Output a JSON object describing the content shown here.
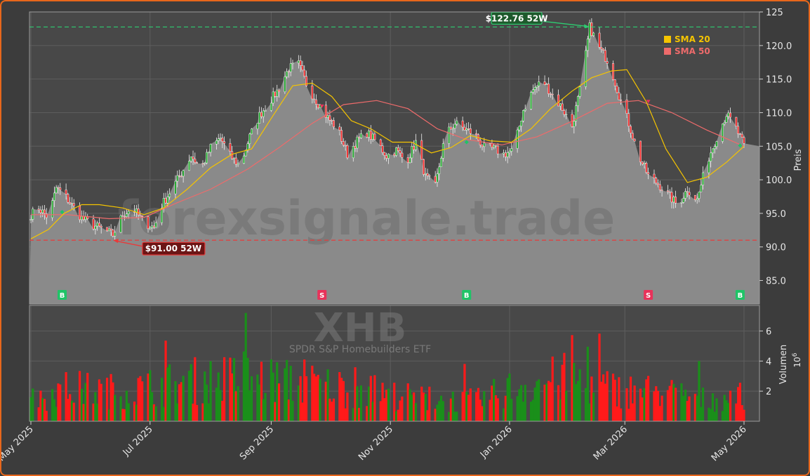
{
  "chart_data": {
    "type": "candlestick",
    "ticker": "XHB",
    "subtitle": "SPDR S&P Homebuilders ETF",
    "watermark": "forexsignale.trade",
    "ylabel": "Preis",
    "volume_label": "Volumen",
    "volume_exponent": "10",
    "volume_exponent_power": "6",
    "price_ylim": [
      81.5,
      125
    ],
    "price_ticks": [
      "85.0",
      "90.0",
      "95.0",
      "100.0",
      "105.0",
      "110.0",
      "115.0",
      "120.0",
      "125"
    ],
    "price_tick_values": [
      85,
      90,
      95,
      100,
      105,
      110,
      115,
      120,
      125
    ],
    "volume_ylim": [
      0,
      7.7
    ],
    "volume_ticks": [
      "2",
      "4",
      "6"
    ],
    "volume_tick_values": [
      2,
      4,
      6
    ],
    "x_ticks": [
      "May 2025",
      "Jul 2025",
      "Sep 2025",
      "Nov 2025",
      "Jan 2026",
      "Mar 2026",
      "May 2026"
    ],
    "x_tick_dates": [
      "2025-05-01",
      "2025-07-01",
      "2025-09-01",
      "2025-11-01",
      "2026-01-01",
      "2026-03-01",
      "2026-05-01"
    ],
    "date_range": [
      "2025-05-01",
      "2026-05-01"
    ],
    "last_price": 105.0,
    "high_52w": {
      "label": "$122.76 52W",
      "value": 122.76,
      "date": "2026-02-11"
    },
    "low_52w": {
      "label": "$91.00 52W",
      "value": 91.0,
      "date": "2025-06-12"
    },
    "legend": [
      {
        "name": "SMA 20",
        "color": "#f5c400"
      },
      {
        "name": "SMA 50",
        "color": "#ee6b6b"
      }
    ],
    "legend_position": "top-right",
    "signals": [
      {
        "type": "buy",
        "label": "B",
        "date": "2025-05-17",
        "price": 95.2
      },
      {
        "type": "sell",
        "label": "S",
        "date": "2025-09-27",
        "price": 111.0
      },
      {
        "type": "buy",
        "label": "B",
        "date": "2025-12-10",
        "price": 105.6
      },
      {
        "type": "sell",
        "label": "S",
        "date": "2026-03-13",
        "price": 111.7
      },
      {
        "type": "buy",
        "label": "B",
        "date": "2026-04-29",
        "price": 105.1
      }
    ],
    "price_path": [
      [
        "2025-05-01",
        94.8
      ],
      [
        "2025-05-05",
        95.8
      ],
      [
        "2025-05-10",
        94.3
      ],
      [
        "2025-05-14",
        98.8
      ],
      [
        "2025-05-18",
        97.8
      ],
      [
        "2025-05-22",
        96.2
      ],
      [
        "2025-05-27",
        94.3
      ],
      [
        "2025-06-02",
        93.2
      ],
      [
        "2025-06-07",
        92.6
      ],
      [
        "2025-06-12",
        91.8
      ],
      [
        "2025-06-17",
        94.8
      ],
      [
        "2025-06-22",
        95.8
      ],
      [
        "2025-06-28",
        93.6
      ],
      [
        "2025-07-03",
        92.9
      ],
      [
        "2025-07-07",
        96.2
      ],
      [
        "2025-07-12",
        98.6
      ],
      [
        "2025-07-17",
        101.0
      ],
      [
        "2025-07-22",
        103.6
      ],
      [
        "2025-07-27",
        101.6
      ],
      [
        "2025-08-01",
        104.8
      ],
      [
        "2025-08-06",
        106.2
      ],
      [
        "2025-08-11",
        103.6
      ],
      [
        "2025-08-16",
        102.0
      ],
      [
        "2025-08-21",
        106.4
      ],
      [
        "2025-08-26",
        109.6
      ],
      [
        "2025-08-31",
        111.6
      ],
      [
        "2025-09-05",
        113.6
      ],
      [
        "2025-09-10",
        116.6
      ],
      [
        "2025-09-15",
        117.2
      ],
      [
        "2025-09-20",
        113.6
      ],
      [
        "2025-09-25",
        111.4
      ],
      [
        "2025-09-30",
        109.2
      ],
      [
        "2025-10-05",
        107.6
      ],
      [
        "2025-10-10",
        103.8
      ],
      [
        "2025-10-15",
        105.8
      ],
      [
        "2025-10-20",
        107.0
      ],
      [
        "2025-10-25",
        105.6
      ],
      [
        "2025-10-30",
        103.6
      ],
      [
        "2025-11-04",
        104.4
      ],
      [
        "2025-11-09",
        102.6
      ],
      [
        "2025-11-14",
        105.6
      ],
      [
        "2025-11-19",
        100.4
      ],
      [
        "2025-11-24",
        99.0
      ],
      [
        "2025-11-29",
        106.6
      ],
      [
        "2025-12-04",
        108.4
      ],
      [
        "2025-12-09",
        107.6
      ],
      [
        "2025-12-14",
        106.8
      ],
      [
        "2025-12-19",
        104.8
      ],
      [
        "2025-12-24",
        104.6
      ],
      [
        "2025-12-29",
        103.8
      ],
      [
        "2026-01-03",
        104.4
      ],
      [
        "2026-01-08",
        110.4
      ],
      [
        "2026-01-13",
        113.4
      ],
      [
        "2026-01-18",
        114.8
      ],
      [
        "2026-01-23",
        112.6
      ],
      [
        "2026-01-28",
        110.6
      ],
      [
        "2026-02-02",
        108.0
      ],
      [
        "2026-02-07",
        114.6
      ],
      [
        "2026-02-11",
        122.76
      ],
      [
        "2026-02-16",
        119.6
      ],
      [
        "2026-02-21",
        117.4
      ],
      [
        "2026-02-26",
        112.6
      ],
      [
        "2026-03-03",
        108.4
      ],
      [
        "2026-03-08",
        103.6
      ],
      [
        "2026-03-13",
        100.6
      ],
      [
        "2026-03-18",
        99.4
      ],
      [
        "2026-03-23",
        97.8
      ],
      [
        "2026-03-28",
        96.2
      ],
      [
        "2026-04-02",
        98.6
      ],
      [
        "2026-04-07",
        97.0
      ],
      [
        "2026-04-12",
        102.6
      ],
      [
        "2026-04-17",
        106.4
      ],
      [
        "2026-04-22",
        109.8
      ],
      [
        "2026-04-27",
        107.6
      ],
      [
        "2026-05-01",
        105.0
      ]
    ],
    "sma20": [
      [
        "2025-05-01",
        91.2
      ],
      [
        "2025-05-10",
        92.6
      ],
      [
        "2025-05-18",
        95.0
      ],
      [
        "2025-05-27",
        96.3
      ],
      [
        "2025-06-05",
        96.3
      ],
      [
        "2025-06-17",
        95.8
      ],
      [
        "2025-06-28",
        94.8
      ],
      [
        "2025-07-08",
        95.8
      ],
      [
        "2025-07-20",
        98.6
      ],
      [
        "2025-08-01",
        101.8
      ],
      [
        "2025-08-12",
        103.8
      ],
      [
        "2025-08-22",
        104.6
      ],
      [
        "2025-09-02",
        109.6
      ],
      [
        "2025-09-12",
        114.0
      ],
      [
        "2025-09-22",
        114.4
      ],
      [
        "2025-10-02",
        112.4
      ],
      [
        "2025-10-12",
        108.8
      ],
      [
        "2025-10-22",
        107.6
      ],
      [
        "2025-11-02",
        105.6
      ],
      [
        "2025-11-12",
        105.6
      ],
      [
        "2025-11-22",
        104.0
      ],
      [
        "2025-12-02",
        104.8
      ],
      [
        "2025-12-12",
        106.6
      ],
      [
        "2025-12-22",
        105.8
      ],
      [
        "2026-01-02",
        105.6
      ],
      [
        "2026-01-12",
        107.6
      ],
      [
        "2026-01-22",
        110.6
      ],
      [
        "2026-02-02",
        113.2
      ],
      [
        "2026-02-12",
        115.2
      ],
      [
        "2026-02-22",
        116.2
      ],
      [
        "2026-03-02",
        116.4
      ],
      [
        "2026-03-12",
        111.6
      ],
      [
        "2026-03-22",
        104.6
      ],
      [
        "2026-04-02",
        99.6
      ],
      [
        "2026-04-12",
        100.4
      ],
      [
        "2026-04-22",
        102.6
      ],
      [
        "2026-05-01",
        105.0
      ]
    ],
    "sma50": [
      [
        "2025-05-01",
        94.8
      ],
      [
        "2025-05-20",
        94.8
      ],
      [
        "2025-06-10",
        94.2
      ],
      [
        "2025-06-28",
        94.4
      ],
      [
        "2025-07-15",
        96.6
      ],
      [
        "2025-08-01",
        98.6
      ],
      [
        "2025-08-20",
        101.6
      ],
      [
        "2025-09-05",
        104.8
      ],
      [
        "2025-09-22",
        108.4
      ],
      [
        "2025-10-08",
        111.2
      ],
      [
        "2025-10-25",
        111.8
      ],
      [
        "2025-11-10",
        110.6
      ],
      [
        "2025-11-25",
        107.6
      ],
      [
        "2025-12-10",
        106.0
      ],
      [
        "2025-12-28",
        105.2
      ],
      [
        "2026-01-15",
        106.4
      ],
      [
        "2026-02-01",
        108.6
      ],
      [
        "2026-02-20",
        111.4
      ],
      [
        "2026-03-08",
        111.8
      ],
      [
        "2026-03-25",
        110.0
      ],
      [
        "2026-04-12",
        107.4
      ],
      [
        "2026-05-01",
        105.0
      ]
    ],
    "volume_path": [
      [
        "2025-05-01",
        1.6
      ],
      [
        "2025-05-20",
        2.4
      ],
      [
        "2025-06-15",
        2.2
      ],
      [
        "2025-07-05",
        2.6
      ],
      [
        "2025-07-25",
        3.0
      ],
      [
        "2025-08-20",
        3.2
      ],
      [
        "2025-09-10",
        2.9
      ],
      [
        "2025-10-01",
        2.6
      ],
      [
        "2025-10-25",
        2.1
      ],
      [
        "2025-11-20",
        1.6
      ],
      [
        "2025-12-15",
        1.5
      ],
      [
        "2026-01-05",
        2.6
      ],
      [
        "2026-01-30",
        3.2
      ],
      [
        "2026-02-25",
        2.3
      ],
      [
        "2026-03-20",
        2.2
      ],
      [
        "2026-04-10",
        1.6
      ],
      [
        "2026-05-01",
        1.9
      ]
    ]
  }
}
